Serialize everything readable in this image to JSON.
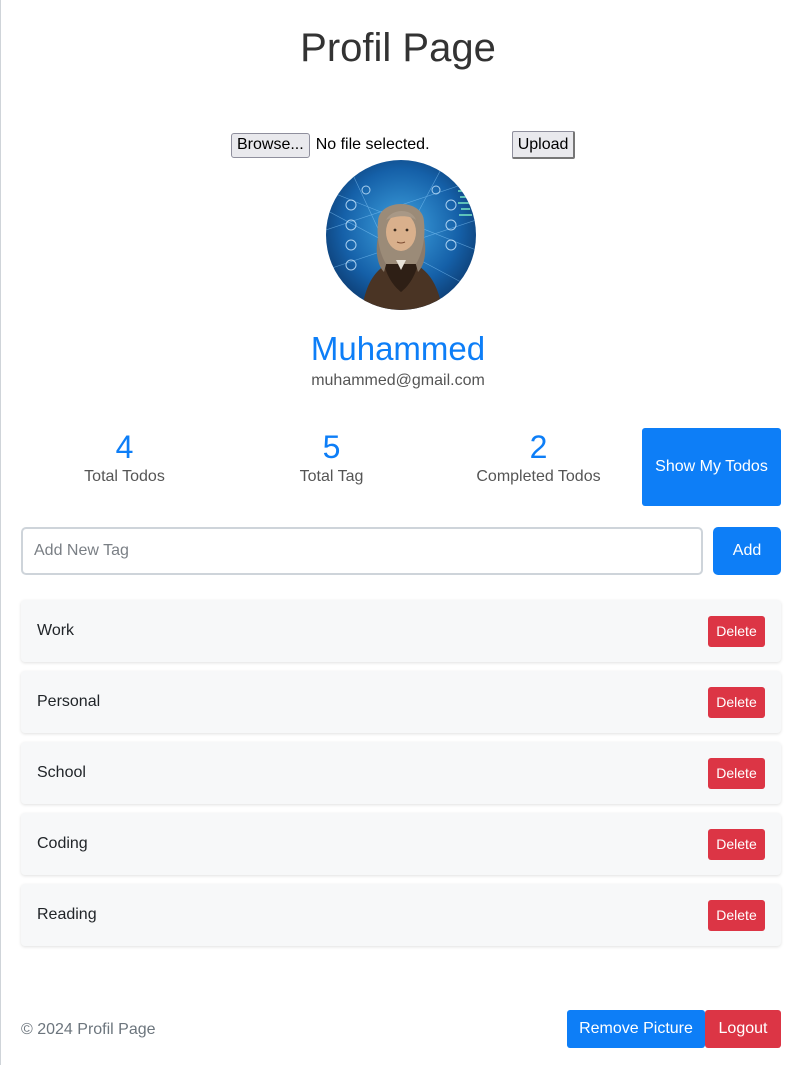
{
  "page": {
    "title": "Profil Page"
  },
  "upload": {
    "browse_label": "Browse...",
    "file_status": "No file selected.",
    "upload_label": "Upload"
  },
  "profile": {
    "name": "Muhammed",
    "email": "muhammed@gmail.com",
    "avatar_icon": "profile-photo"
  },
  "stats": [
    {
      "value": "4",
      "label": "Total Todos"
    },
    {
      "value": "5",
      "label": "Total Tag"
    },
    {
      "value": "2",
      "label": "Completed Todos"
    }
  ],
  "actions": {
    "show_todos_label": "Show My Todos"
  },
  "tag_form": {
    "placeholder": "Add New Tag",
    "add_label": "Add"
  },
  "tags": [
    {
      "name": "Work",
      "delete_label": "Delete"
    },
    {
      "name": "Personal",
      "delete_label": "Delete"
    },
    {
      "name": "School",
      "delete_label": "Delete"
    },
    {
      "name": "Coding",
      "delete_label": "Delete"
    },
    {
      "name": "Reading",
      "delete_label": "Delete"
    }
  ],
  "footer": {
    "copyright": "© 2024 Profil Page",
    "remove_picture_label": "Remove Picture",
    "logout_label": "Logout"
  },
  "colors": {
    "primary": "#0d7ef7",
    "danger": "#dc3545",
    "card_bg": "#f7f8f9"
  }
}
